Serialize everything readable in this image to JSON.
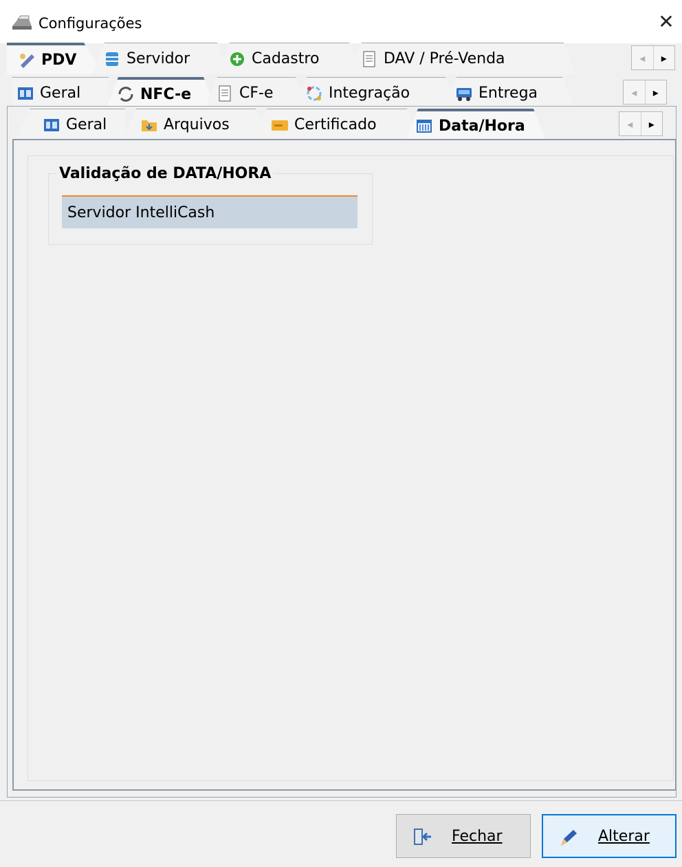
{
  "window": {
    "title": "Configurações",
    "close_glyph": "✕"
  },
  "top_tabs": [
    {
      "label": "PDV",
      "icon": "wrench-icon",
      "active": true
    },
    {
      "label": "Servidor",
      "icon": "database-icon"
    },
    {
      "label": "Cadastro",
      "icon": "plus-circle-icon"
    },
    {
      "label": "DAV / Pré-Venda",
      "icon": "document-icon"
    }
  ],
  "second_tabs": [
    {
      "label": "Geral",
      "icon": "panel-icon"
    },
    {
      "label": "NFC-e",
      "icon": "refresh-icon",
      "active": true
    },
    {
      "label": "CF-e",
      "icon": "document-icon"
    },
    {
      "label": "Integração",
      "icon": "sync-icon"
    },
    {
      "label": "Entrega",
      "icon": "truck-icon"
    }
  ],
  "third_tabs": [
    {
      "label": "Geral",
      "icon": "panel-icon"
    },
    {
      "label": "Arquivos",
      "icon": "folder-icon"
    },
    {
      "label": "Certificado",
      "icon": "certificate-icon"
    },
    {
      "label": "Data/Hora",
      "icon": "calendar-icon",
      "active": true
    }
  ],
  "arrows": {
    "left": "◂",
    "right": "▸"
  },
  "group": {
    "title": "Validação de DATA/HORA",
    "items": [
      "Servidor IntelliCash"
    ]
  },
  "buttons": {
    "close_label": "Fechar",
    "edit_label": "Alterar"
  },
  "colors": {
    "accent": "#0078d7",
    "selection": "#c8d4df",
    "highlight": "#f08a24"
  }
}
